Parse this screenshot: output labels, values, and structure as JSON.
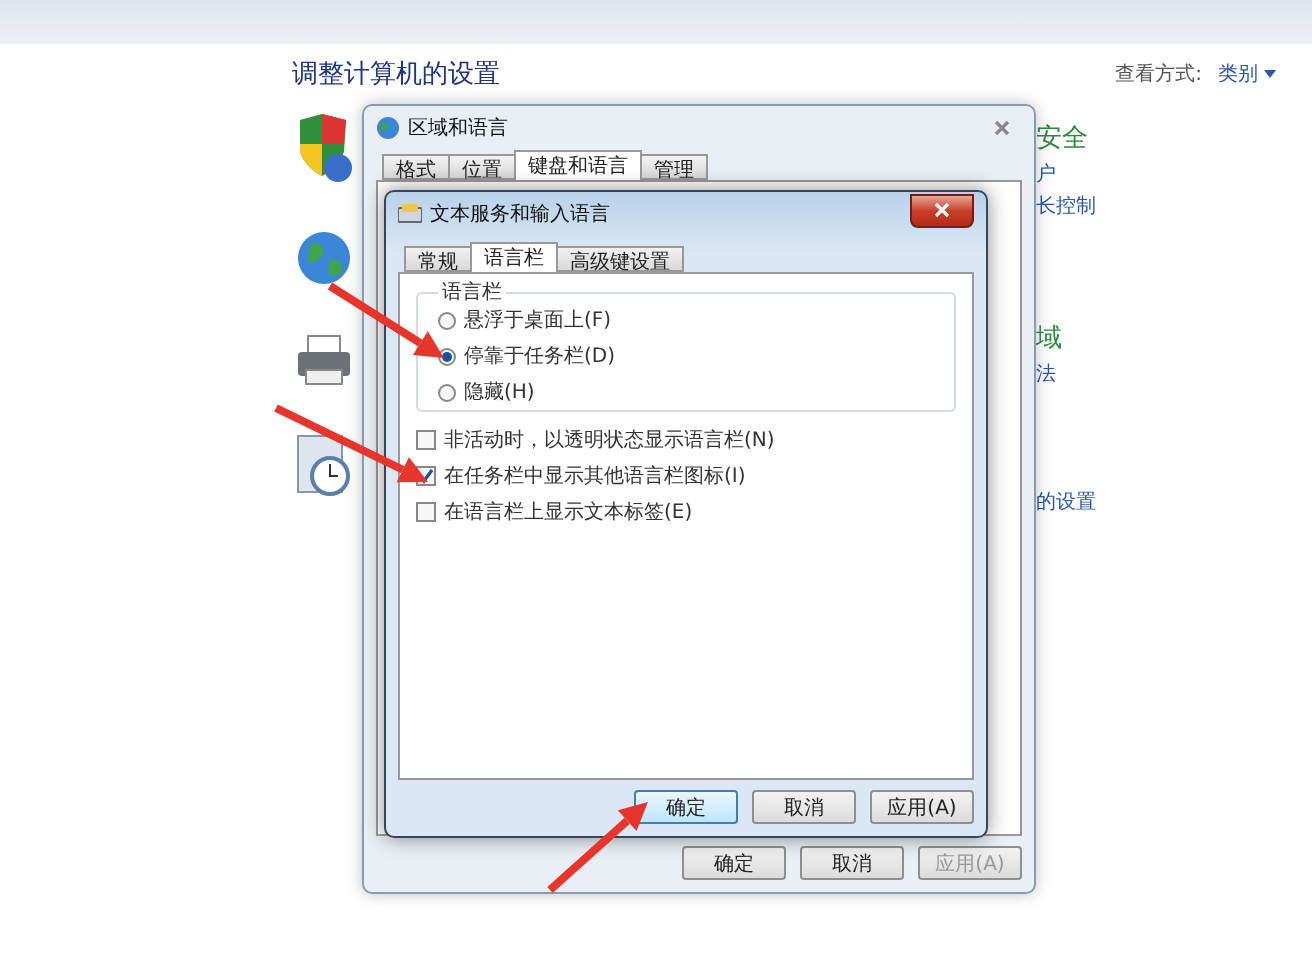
{
  "control_panel": {
    "title": "调整计算机的设置",
    "view_by_label": "查看方式:",
    "view_by_value": "类别",
    "categories": [
      {
        "heading": "安全",
        "links": [
          "户",
          "长控制"
        ]
      },
      {
        "heading": "域",
        "links": [
          "法"
        ]
      },
      {
        "links": [
          "的设置"
        ]
      }
    ]
  },
  "region_dialog": {
    "title": "区域和语言",
    "tabs": [
      {
        "label": "格式",
        "selected": false
      },
      {
        "label": "位置",
        "selected": false
      },
      {
        "label": "键盘和语言",
        "selected": true
      },
      {
        "label": "管理",
        "selected": false
      }
    ],
    "buttons": [
      {
        "label": "确定",
        "disabled": false
      },
      {
        "label": "取消",
        "disabled": false
      },
      {
        "label": "应用(A)",
        "disabled": true
      }
    ]
  },
  "text_services_dialog": {
    "title": "文本服务和输入语言",
    "tabs": [
      {
        "label": "常规",
        "selected": false
      },
      {
        "label": "语言栏",
        "selected": true
      },
      {
        "label": "高级键设置",
        "selected": false
      }
    ],
    "language_bar_group": {
      "title": "语言栏",
      "options": [
        {
          "label": "悬浮于桌面上(F)",
          "selected": false
        },
        {
          "label": "停靠于任务栏(D)",
          "selected": true
        },
        {
          "label": "隐藏(H)",
          "selected": false
        }
      ]
    },
    "checkboxes": [
      {
        "label": "非活动时，以透明状态显示语言栏(N)",
        "checked": false
      },
      {
        "label": "在任务栏中显示其他语言栏图标(I)",
        "checked": true
      },
      {
        "label": "在语言栏上显示文本标签(E)",
        "checked": false
      }
    ],
    "buttons": [
      {
        "label": "确定",
        "focused": true
      },
      {
        "label": "取消",
        "focused": false
      },
      {
        "label": "应用(A)",
        "focused": false
      }
    ]
  }
}
